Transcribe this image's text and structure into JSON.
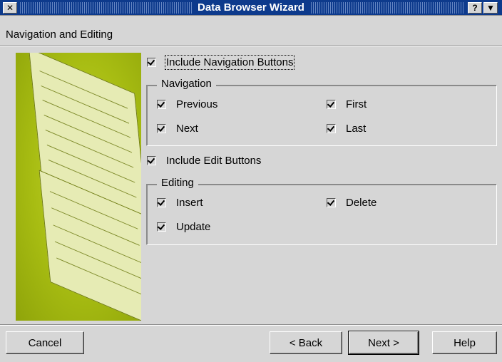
{
  "window": {
    "title": "Data Browser Wizard",
    "help_button": "?",
    "menu_button": "▼",
    "close_button": "✕"
  },
  "page": {
    "heading": "Navigation and Editing"
  },
  "options": {
    "include_navigation": {
      "label": "Include Navigation Buttons",
      "checked": true
    },
    "navigation_group": {
      "title": "Navigation",
      "items": [
        {
          "label": "Previous",
          "checked": true
        },
        {
          "label": "First",
          "checked": true
        },
        {
          "label": "Next",
          "checked": true
        },
        {
          "label": "Last",
          "checked": true
        }
      ]
    },
    "include_edit": {
      "label": "Include Edit Buttons",
      "checked": true
    },
    "editing_group": {
      "title": "Editing",
      "items": [
        {
          "label": "Insert",
          "checked": true
        },
        {
          "label": "Delete",
          "checked": true
        },
        {
          "label": "Update",
          "checked": true
        }
      ]
    }
  },
  "buttons": {
    "cancel": "Cancel",
    "back": "< Back",
    "next": "Next >",
    "help": "Help"
  }
}
